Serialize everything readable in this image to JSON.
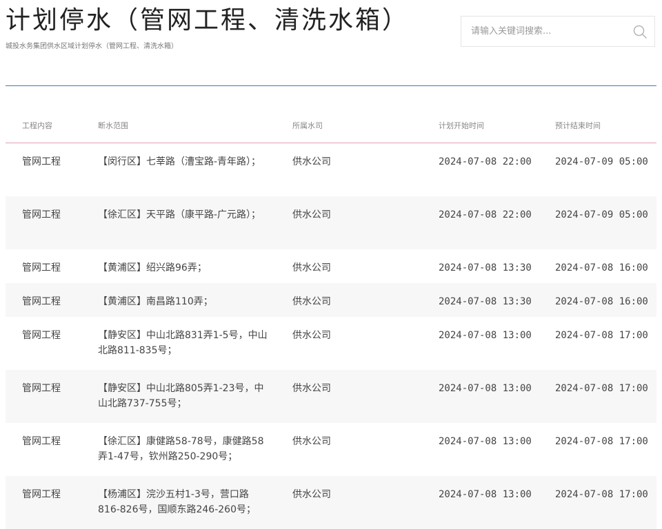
{
  "header": {
    "title": "计划停水（管网工程、清洗水箱）",
    "subtitle": "城投水务集团供水区域计划停水（管网工程、清洗水箱）"
  },
  "search": {
    "placeholder": "请输入关键词搜索..."
  },
  "icons": {
    "search": "search-icon"
  },
  "colors": {
    "divider": "#3c78c8",
    "header_border": "#e0a0b0",
    "alt_row": "#f7f7f7"
  },
  "table": {
    "columns": [
      "工程内容",
      "断水范围",
      "所属水司",
      "计划开始时间",
      "预计结束时间"
    ],
    "rows": [
      {
        "type": "管网工程",
        "area": "【闵行区】七莘路（漕宝路-青年路）；",
        "company": "供水公司",
        "start": "2024-07-08 22:00",
        "end": "2024-07-09 05:00"
      },
      {
        "type": "管网工程",
        "area": "【徐汇区】天平路（康平路-广元路）；",
        "company": "供水公司",
        "start": "2024-07-08 22:00",
        "end": "2024-07-09 05:00"
      },
      {
        "type": "管网工程",
        "area": "【黄浦区】绍兴路96弄；",
        "company": "供水公司",
        "start": "2024-07-08 13:30",
        "end": "2024-07-08 16:00"
      },
      {
        "type": "管网工程",
        "area": "【黄浦区】南昌路110弄；",
        "company": "供水公司",
        "start": "2024-07-08 13:30",
        "end": "2024-07-08 16:00"
      },
      {
        "type": "管网工程",
        "area": "【静安区】中山北路831弄1-5号，中山北路811-835号；",
        "company": "供水公司",
        "start": "2024-07-08 13:00",
        "end": "2024-07-08 17:00"
      },
      {
        "type": "管网工程",
        "area": "【静安区】中山北路805弄1-23号，中山北路737-755号；",
        "company": "供水公司",
        "start": "2024-07-08 13:00",
        "end": "2024-07-08 17:00"
      },
      {
        "type": "管网工程",
        "area": "【徐汇区】康健路58-78号，康健路58弄1-47号，钦州路250-290号；",
        "company": "供水公司",
        "start": "2024-07-08 13:00",
        "end": "2024-07-08 17:00"
      },
      {
        "type": "管网工程",
        "area": "【杨浦区】浣沙五村1-3号，营口路816-826号，国顺东路246-260号；",
        "company": "供水公司",
        "start": "2024-07-08 13:00",
        "end": "2024-07-08 17:00"
      }
    ]
  }
}
